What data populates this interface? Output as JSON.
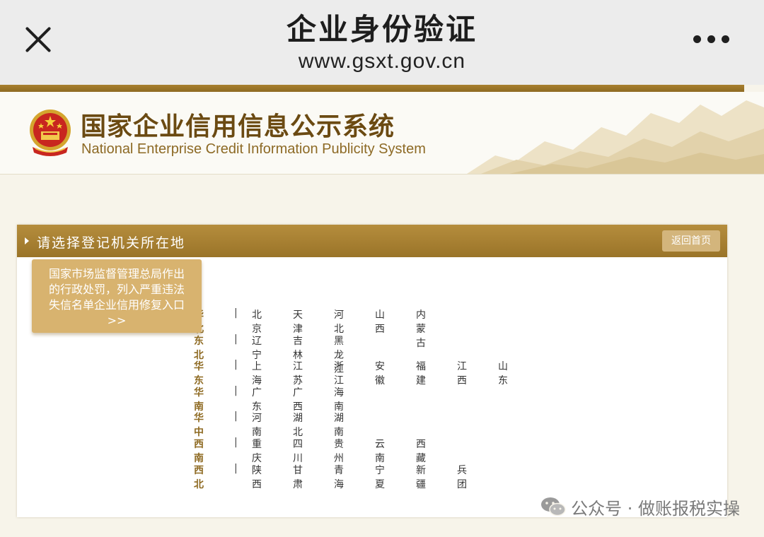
{
  "topbar": {
    "title": "企业身份验证",
    "url": "www.gsxt.gov.cn"
  },
  "site": {
    "title_cn": "国家企业信用信息公示系统",
    "title_en": "National Enterprise Credit Information Publicity System"
  },
  "panel": {
    "title": "请选择登记机关所在地",
    "back_label": "返回首页"
  },
  "notice": {
    "line1": "国家市场监督管理总局作出",
    "line2": "的行政处罚，列入严重违法",
    "line3": "失信名单企业信用修复入口",
    "line4": ">>"
  },
  "regions": [
    {
      "name": "华北",
      "separator": "|",
      "provinces": [
        "北京",
        "天津",
        "河北",
        "山西",
        "内蒙古"
      ]
    },
    {
      "name": "东北",
      "separator": "|",
      "provinces": [
        "辽宁",
        "吉林",
        "黑龙江"
      ]
    },
    {
      "name": "华东",
      "separator": "|",
      "provinces": [
        "上海",
        "江苏",
        "浙江",
        "安徽",
        "福建",
        "江西",
        "山东"
      ]
    },
    {
      "name": "华南",
      "separator": "|",
      "provinces": [
        "广东",
        "广西",
        "海南"
      ]
    },
    {
      "name": "华中",
      "separator": "|",
      "provinces": [
        "河南",
        "湖北",
        "湖南"
      ]
    },
    {
      "name": "西南",
      "separator": "|",
      "provinces": [
        "重庆",
        "四川",
        "贵州",
        "云南",
        "西藏"
      ]
    },
    {
      "name": "西北",
      "separator": "|",
      "provinces": [
        "陕西",
        "甘肃",
        "青海",
        "宁夏",
        "新疆",
        "兵团"
      ]
    }
  ],
  "watermark": {
    "text": "公众号 · 做账报税实操"
  },
  "colors": {
    "gold": "#9a7428",
    "brand_brown": "#6b4a12",
    "notice_bg": "#d8b36f"
  }
}
